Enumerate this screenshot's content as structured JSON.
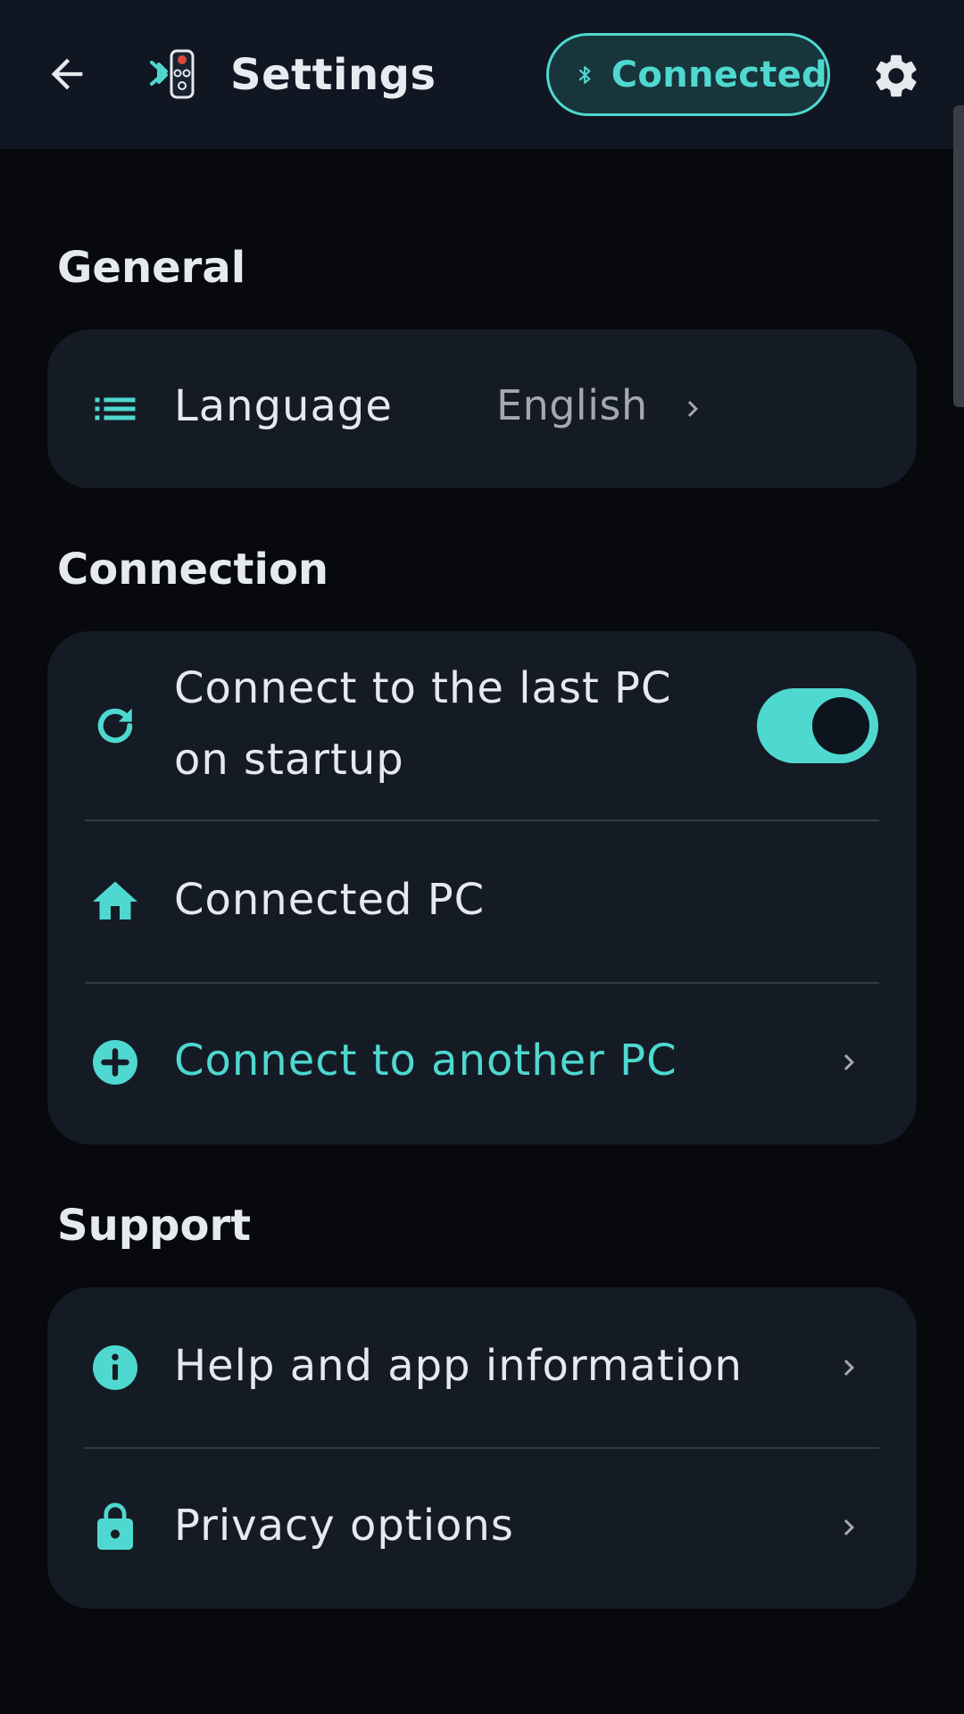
{
  "header": {
    "title": "Settings",
    "status_label": "Connected",
    "back_icon": "arrow-left-icon",
    "logo_icon": "bluetooth-remote-logo",
    "status_icon": "bluetooth-icon",
    "settings_icon": "gear-icon"
  },
  "sections": {
    "general": {
      "title": "General",
      "language": {
        "label": "Language",
        "value": "English",
        "icon": "list-icon"
      }
    },
    "connection": {
      "title": "Connection",
      "auto_connect": {
        "label_line1": "Connect to the last PC",
        "label_line2": "on startup",
        "enabled": true,
        "icon": "refresh-icon"
      },
      "connected_pc": {
        "label": "Connected PC",
        "icon": "home-icon"
      },
      "connect_another": {
        "label": "Connect to another PC",
        "icon": "add-circle-icon"
      }
    },
    "support": {
      "title": "Support",
      "help": {
        "label": "Help and app information",
        "icon": "info-icon"
      },
      "privacy": {
        "label": "Privacy options",
        "icon": "lock-icon"
      }
    }
  },
  "colors": {
    "accent": "#4fd8cf",
    "background": "#07090d",
    "topbar": "#111722",
    "card": "#151b25",
    "text": "#e6e9ee",
    "muted_text": "#a3a8b1"
  }
}
